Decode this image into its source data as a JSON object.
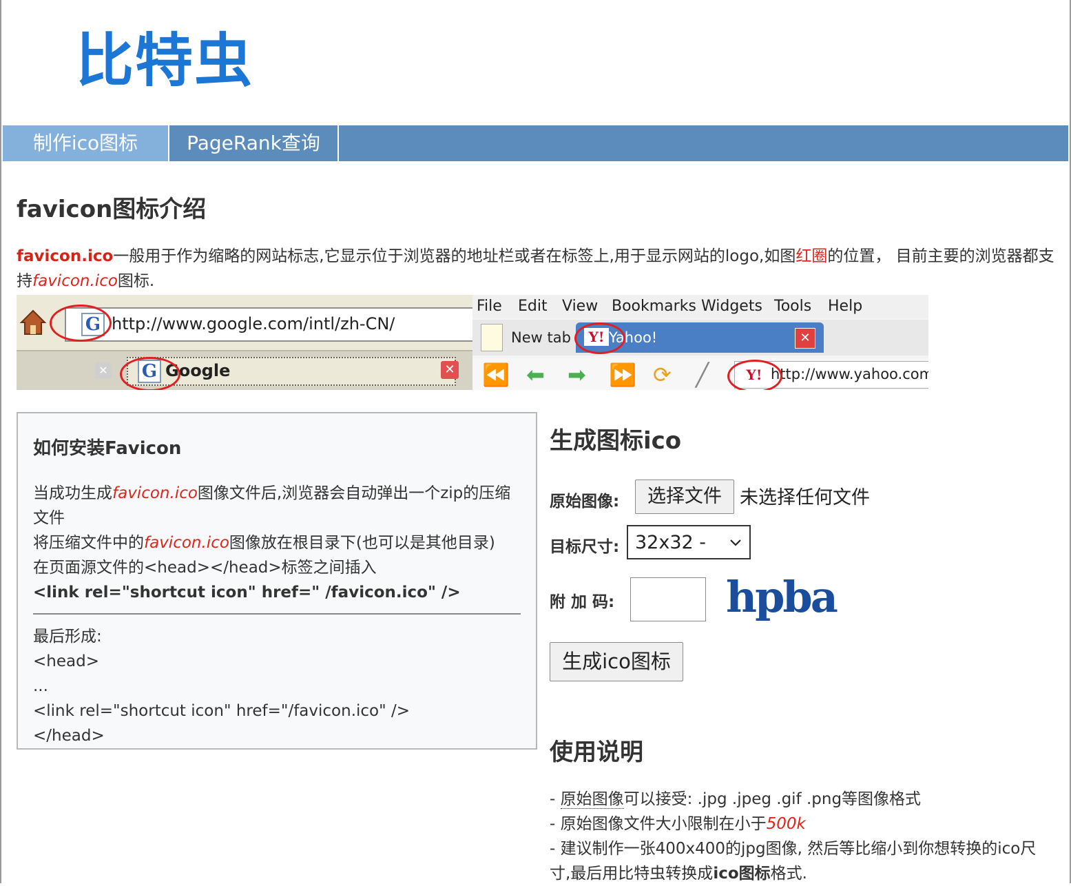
{
  "site": {
    "logo": "比特虫"
  },
  "nav": {
    "items": [
      {
        "label": "制作ico图标",
        "active": true
      },
      {
        "label": "PageRank查询",
        "active": false
      }
    ]
  },
  "intro": {
    "title": "favicon图标介绍",
    "p1_brand": "favicon.ico",
    "p1_text_a": "一般用于作为缩略的网站标志,它显示位于浏览器的地址栏或者在标签上,用于显示网站的logo,如图",
    "p1_red_circle": "红圈",
    "p1_text_b": "的位置，  目前主要的浏览器都支持",
    "p1_italic": "favicon.ico",
    "p1_text_c": "图标."
  },
  "screenshot_left": {
    "url": "http://www.google.com/intl/zh-CN/",
    "tab_label": "Google",
    "favicon_letter": "G"
  },
  "screenshot_right": {
    "menu": [
      "File",
      "Edit",
      "View",
      "Bookmarks",
      "Widgets",
      "Tools",
      "Help"
    ],
    "new_tab": "New tab",
    "active_tab": "Yahoo!",
    "url": "http://www.yahoo.com",
    "favicon_letter": "Y!"
  },
  "install": {
    "title": "如何安装Favicon",
    "line1_a": "当成功生成",
    "line1_italic": "favicon.ico",
    "line1_b": "图像文件后,浏览器会自动弹出一个zip的压缩文件",
    "line2_a": "将压缩文件中的",
    "line2_italic": "favicon.ico",
    "line2_b": "图像放在根目录下(也可以是其他目录)",
    "line3": "在页面源文件的<head></head>标签之间插入",
    "line4_code": "<link rel=\"shortcut icon\" href=\" /favicon.ico\" />",
    "final_label": "最后形成:",
    "final_lines": [
      "<head>",
      "...",
      "<link rel=\"shortcut icon\" href=\"/favicon.ico\" />",
      "</head>"
    ]
  },
  "generator": {
    "title": "生成图标ico",
    "source_label": "原始图像:",
    "file_button": "选择文件",
    "file_status": "未选择任何文件",
    "size_label": "目标尺寸:",
    "size_value": "32x32 -",
    "captcha_label": "附 加 码:",
    "captcha_text": "hpba",
    "submit_button": "生成ico图标"
  },
  "usage": {
    "title": "使用说明",
    "l1_prefix": "- ",
    "l1_dotted": "原始图像",
    "l1_rest": "可以接受: .jpg .jpeg .gif .png等图像格式",
    "l2_prefix": "- 原始图像文件大小限制在小于",
    "l2_red": "500k",
    "l3_a": "- 建议制作一张400x400的jpg图像, 然后等比缩小到你想转换的ico尺寸,最后用比特虫转换成",
    "l3_bold": "ico图标",
    "l3_b": "格式."
  },
  "colors": {
    "brand_blue": "#1c76d6",
    "nav_bg": "#5b8cbc",
    "nav_active": "#84b0dc",
    "accent_red": "#e0241b"
  }
}
